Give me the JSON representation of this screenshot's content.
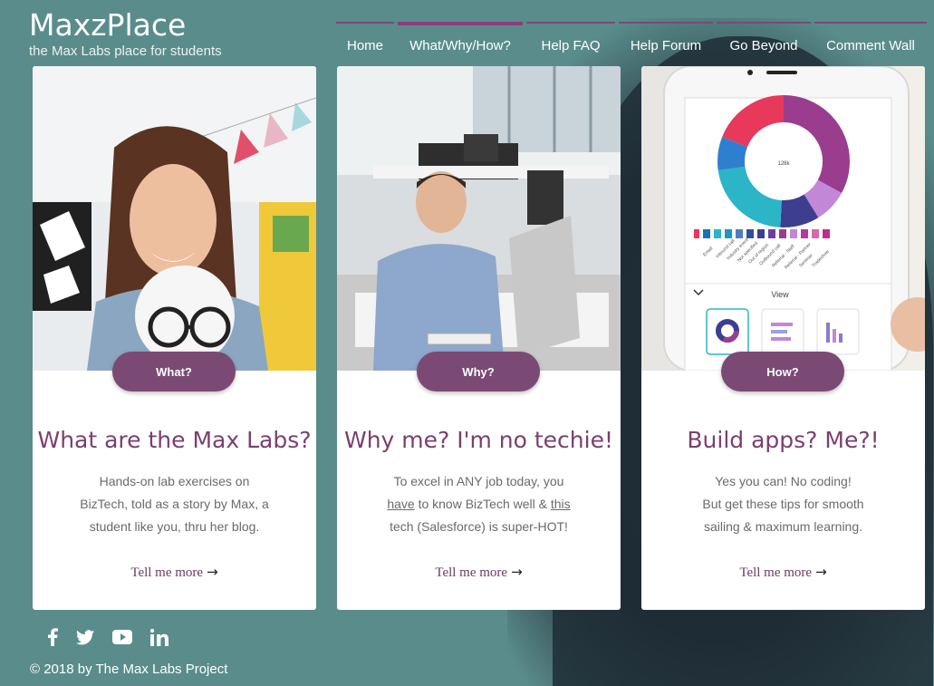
{
  "brand": {
    "title": "MaxzPlace",
    "subtitle": "the Max Labs place for students"
  },
  "nav": [
    {
      "label": "Home"
    },
    {
      "label": "What/Why/How?"
    },
    {
      "label": "Help FAQ"
    },
    {
      "label": "Help Forum"
    },
    {
      "label": "Go Beyond"
    },
    {
      "label": "Comment Wall"
    }
  ],
  "cards": [
    {
      "button": "What?",
      "title": "What are the Max Labs?",
      "lines": [
        "Hands-on lab exercises on",
        "BizTech, told as a story by Max, a",
        "student like you, thru her blog."
      ],
      "more": "Tell me more"
    },
    {
      "button": "Why?",
      "title": "Why me? I'm no techie!",
      "line1": "To excel in ANY job today, you",
      "line2_link1": "have",
      "line2_mid": " to know BizTech well & ",
      "line2_link2": "this",
      "line3": "tech (Salesforce) is super-HOT!",
      "more": "Tell me more"
    },
    {
      "button": "How?",
      "title": "Build apps? Me?!",
      "lines": [
        "Yes you can! No coding!",
        "But get these tips for smooth",
        "sailing & maximum learning."
      ],
      "more": "Tell me more"
    }
  ],
  "phone_screen": {
    "center_value": "128k",
    "view_label": "View",
    "legend_items": [
      "Email",
      "Inbound call",
      "Industry event",
      "Not specified",
      "Out of region",
      "Outbound call",
      "Referral - Staff",
      "Referral - Partner",
      "Seminar",
      "Tradeshow"
    ]
  },
  "footer": {
    "copyright": "© 2018 by The Max Labs Project"
  },
  "colors": {
    "background": "#5a8c8c",
    "accent": "#7b4a74",
    "title": "#7b3f6e"
  }
}
